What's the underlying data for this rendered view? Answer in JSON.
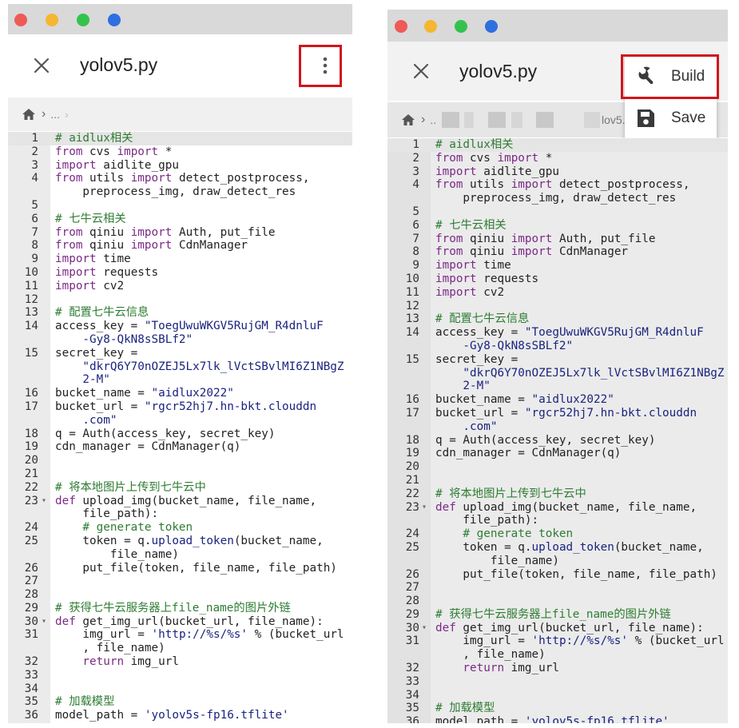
{
  "screens": [
    {
      "id": "left",
      "title": "yolov5.py",
      "breadcrumb": {
        "ellipsis": "...",
        "trail": "›"
      },
      "menu": null
    },
    {
      "id": "right",
      "title": "yolov5.py",
      "breadcrumb": {
        "ellipsis": "..",
        "trail": "lov5.."
      },
      "menu": {
        "items": [
          {
            "label": "Build",
            "icon": "wrench-icon"
          },
          {
            "label": "Save",
            "icon": "save-icon"
          }
        ]
      }
    }
  ],
  "window_dots": {
    "colors": [
      "#ee5a56",
      "#f5b731",
      "#35c24c",
      "#2f6fe0"
    ]
  },
  "highlight_color": "#d0151c",
  "code_lines": [
    {
      "n": "1",
      "t": [
        [
          "cm",
          "# aidlux相关"
        ]
      ],
      "hl": true
    },
    {
      "n": "2",
      "t": [
        [
          "kw",
          "from"
        ],
        [
          "p",
          " cvs "
        ],
        [
          "kw",
          "import"
        ],
        [
          "p",
          " *"
        ]
      ]
    },
    {
      "n": "3",
      "t": [
        [
          "kw",
          "import"
        ],
        [
          "p",
          " aidlite_gpu"
        ]
      ]
    },
    {
      "n": "4",
      "t": [
        [
          "kw",
          "from"
        ],
        [
          "p",
          " utils "
        ],
        [
          "kw",
          "import"
        ],
        [
          "p",
          " detect_postprocess,"
        ]
      ]
    },
    {
      "n": "",
      "t": [
        [
          "p",
          "    preprocess_img, draw_detect_res"
        ]
      ]
    },
    {
      "n": "5",
      "t": []
    },
    {
      "n": "6",
      "t": [
        [
          "cm",
          "# 七牛云相关"
        ]
      ]
    },
    {
      "n": "7",
      "t": [
        [
          "kw",
          "from"
        ],
        [
          "p",
          " qiniu "
        ],
        [
          "kw",
          "import"
        ],
        [
          "p",
          " Auth, put_file"
        ]
      ]
    },
    {
      "n": "8",
      "t": [
        [
          "kw",
          "from"
        ],
        [
          "p",
          " qiniu "
        ],
        [
          "kw",
          "import"
        ],
        [
          "p",
          " CdnManager"
        ]
      ]
    },
    {
      "n": "9",
      "t": [
        [
          "kw",
          "import"
        ],
        [
          "p",
          " time"
        ]
      ]
    },
    {
      "n": "10",
      "t": [
        [
          "kw",
          "import"
        ],
        [
          "p",
          " requests"
        ]
      ]
    },
    {
      "n": "11",
      "t": [
        [
          "kw",
          "import"
        ],
        [
          "p",
          " cv2"
        ]
      ]
    },
    {
      "n": "12",
      "t": []
    },
    {
      "n": "13",
      "t": [
        [
          "cm",
          "# 配置七牛云信息"
        ]
      ]
    },
    {
      "n": "14",
      "t": [
        [
          "p",
          "access_key = "
        ],
        [
          "st",
          "\"ToegUwuWKGV5RujGM_R4dnluF"
        ]
      ]
    },
    {
      "n": "",
      "t": [
        [
          "st",
          "    -Gy8-QkN8sSBLf2\""
        ]
      ]
    },
    {
      "n": "15",
      "t": [
        [
          "p",
          "secret_key ="
        ]
      ]
    },
    {
      "n": "",
      "t": [
        [
          "st",
          "    \"dkrQ6Y70nOZEJ5Lx7lk_lVctSBvlMI6Z1NBgZ"
        ]
      ]
    },
    {
      "n": "",
      "t": [
        [
          "st",
          "    2-M\""
        ]
      ]
    },
    {
      "n": "16",
      "t": [
        [
          "p",
          "bucket_name = "
        ],
        [
          "st",
          "\"aidlux2022\""
        ]
      ]
    },
    {
      "n": "17",
      "t": [
        [
          "p",
          "bucket_url = "
        ],
        [
          "st",
          "\"rgcr52hj7.hn-bkt.clouddn"
        ]
      ]
    },
    {
      "n": "",
      "t": [
        [
          "st",
          "    .com\""
        ]
      ]
    },
    {
      "n": "18",
      "t": [
        [
          "p",
          "q = Auth(access_key, secret_key)"
        ]
      ]
    },
    {
      "n": "19",
      "t": [
        [
          "p",
          "cdn_manager = CdnManager(q)"
        ]
      ]
    },
    {
      "n": "20",
      "t": []
    },
    {
      "n": "21",
      "t": []
    },
    {
      "n": "22",
      "t": [
        [
          "cm",
          "# 将本地图片上传到七牛云中"
        ]
      ]
    },
    {
      "n": "23",
      "fold": true,
      "t": [
        [
          "kw",
          "def"
        ],
        [
          "p",
          " upload_img(bucket_name, file_name,"
        ]
      ]
    },
    {
      "n": "",
      "t": [
        [
          "p",
          "    file_path):"
        ]
      ]
    },
    {
      "n": "24",
      "t": [
        [
          "cm",
          "    # generate token"
        ]
      ]
    },
    {
      "n": "25",
      "t": [
        [
          "p",
          "    token = q."
        ],
        [
          "st",
          "upload_token"
        ],
        [
          "p",
          "(bucket_name,"
        ]
      ]
    },
    {
      "n": "",
      "t": [
        [
          "p",
          "        file_name)"
        ]
      ]
    },
    {
      "n": "26",
      "t": [
        [
          "p",
          "    put_file(token, file_name, file_path)"
        ]
      ]
    },
    {
      "n": "27",
      "t": []
    },
    {
      "n": "28",
      "t": []
    },
    {
      "n": "29",
      "t": [
        [
          "cm",
          "# 获得七牛云服务器上file_name的图片外链"
        ]
      ]
    },
    {
      "n": "30",
      "fold": true,
      "t": [
        [
          "kw",
          "def"
        ],
        [
          "p",
          " get_img_url(bucket_url, file_name):"
        ]
      ]
    },
    {
      "n": "31",
      "t": [
        [
          "p",
          "    img_url = "
        ],
        [
          "st",
          "'http://%s/%s'"
        ],
        [
          "p",
          " % (bucket_url"
        ]
      ]
    },
    {
      "n": "",
      "t": [
        [
          "p",
          "    , file_name)"
        ]
      ]
    },
    {
      "n": "32",
      "t": [
        [
          "kw",
          "    return"
        ],
        [
          "p",
          " img_url"
        ]
      ]
    },
    {
      "n": "33",
      "t": []
    },
    {
      "n": "34",
      "t": []
    },
    {
      "n": "35",
      "t": [
        [
          "cm",
          "# 加载模型"
        ]
      ]
    },
    {
      "n": "36",
      "t": [
        [
          "p",
          "model_path = "
        ],
        [
          "st",
          "'yolov5s-fp16.tflite'"
        ]
      ]
    }
  ]
}
